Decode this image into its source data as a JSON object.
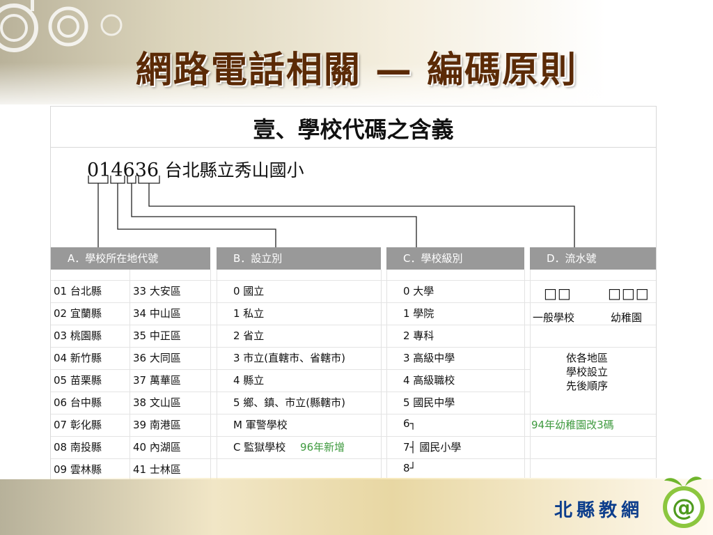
{
  "title": "網路電話相關 — 編碼原則",
  "panel_title": "壹、學校代碼之含義",
  "example": {
    "code": "014636",
    "name": "台北縣立秀山國小"
  },
  "columns": [
    "A．學校所在地代號",
    "B．設立別",
    "C．學校級別",
    "D．流水號"
  ],
  "col_a_left": [
    "01 台北縣",
    "02 宜蘭縣",
    "03 桃園縣",
    "04 新竹縣",
    "05 苗栗縣",
    "06 台中縣",
    "07 彰化縣",
    "08 南投縣",
    "09 雲林縣"
  ],
  "col_a_right": [
    "33 大安區",
    "34 中山區",
    "35 中正區",
    "36 大同區",
    "37 萬華區",
    "38 文山區",
    "39 南港區",
    "40 內湖區",
    "41 士林區"
  ],
  "col_b": [
    "0 國立",
    "1 私立",
    "2 省立",
    "3 市立(直轄市、省轄市)",
    "4 縣立",
    "5 鄉、鎮、市立(縣轄市)",
    "M 軍警學校",
    "C 監獄學校"
  ],
  "col_b_note": "96年新增",
  "col_c": [
    "0 大學",
    "1 學院",
    "2 專科",
    "3 高級中學",
    "4 高級職校",
    "5 國民中學",
    "6┐",
    "7┤ 國民小學",
    "8┘"
  ],
  "col_d": {
    "boxes_general": "□□",
    "boxes_kinder": "□□□",
    "label_general": "一般學校",
    "label_kinder": "幼稚園",
    "order_lines": [
      "依各地區",
      "學校設立",
      "先後順序"
    ],
    "note": "94年幼稚園改3碼"
  },
  "logo_text": "北縣教網",
  "colors": {
    "title": "#5b2a06",
    "header_bg": "#999999",
    "note_green": "#3f9a3f",
    "logo_blue": "#0d3e8c"
  }
}
